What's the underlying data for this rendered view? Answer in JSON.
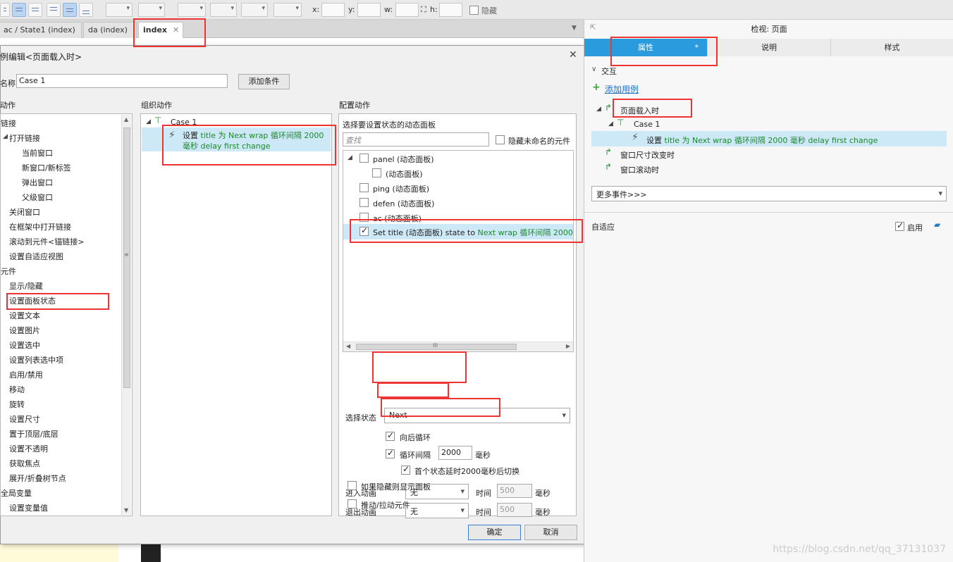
{
  "toolbar": {
    "x_label": "x:",
    "y_label": "y:",
    "w_label": "w:",
    "h_label": "h:",
    "hidden_label": "隐藏"
  },
  "tabs": [
    {
      "label": "ac / State1 (index)"
    },
    {
      "label": "da (index)"
    },
    {
      "label": "index",
      "close": "✕"
    }
  ],
  "dialog": {
    "title": "例编辑<页面载入时>",
    "close": "✕",
    "name_label": "名称",
    "name_value": "Case 1",
    "add_condition": "添加条件",
    "col1_header": "动作",
    "col2_header": "组织动作",
    "col3_header": "配置动作",
    "actions": [
      "链接",
      "打开链接",
      "当前窗口",
      "新窗口/新标签",
      "弹出窗口",
      "父级窗口",
      "关闭窗口",
      "在框架中打开链接",
      "滚动到元件<锚链接>",
      "设置自适应视图",
      "元件",
      "显示/隐藏",
      "设置面板状态",
      "设置文本",
      "设置图片",
      "设置选中",
      "设置列表选中项",
      "启用/禁用",
      "移动",
      "旋转",
      "设置尺寸",
      "置于顶层/底层",
      "设置不透明",
      "获取焦点",
      "展开/折叠树节点",
      "全局变量",
      "设置变量值"
    ],
    "organize": {
      "case": "Case 1",
      "action_prefix": "设置",
      "action_text": "title 为 Next wrap 循环间隔 2000 毫秒 delay first change"
    },
    "config": {
      "select_panel_label": "选择要设置状态的动态面板",
      "search_placeholder": "查找",
      "hide_unnamed": "隐藏未命名的元件",
      "panels": [
        "panel (动态面板)",
        "(动态面板)",
        "ping (动态面板)",
        "defen (动态面板)",
        "ac (动态面板)"
      ],
      "selected_prefix": "Set title (动态面板) state to",
      "selected_suffix": "Next wrap 循环间隔 2000 毫秒",
      "scroll_grip": "III",
      "select_state_label": "选择状态",
      "state_value": "Next",
      "wrap_label": "向后循环",
      "interval_label": "循环间隔",
      "interval_value": "2000",
      "ms": "毫秒",
      "first_delay_label": "首个状态延时2000毫秒后切换",
      "enter_anim_label": "进入动画",
      "exit_anim_label": "退出动画",
      "anim_value": "无",
      "time_label": "时间",
      "time_value": "500",
      "show_if_hidden": "如果隐藏则显示面板",
      "push_widgets": "推动/拉动元件"
    },
    "ok": "确定",
    "cancel": "取消"
  },
  "inspector": {
    "header": "检视: 页面",
    "tabs": [
      "属性",
      "说明",
      "样式"
    ],
    "tab_star": "*",
    "interaction_label": "交互",
    "add_case": "添加用例",
    "events": {
      "page_load": "页面载入时",
      "case": "Case 1",
      "action_prefix": "设置",
      "action_text": "title 为 Next wrap 循环间隔 2000 毫秒 delay first change",
      "resize": "窗口尺寸改变时",
      "scroll": "窗口滚动时"
    },
    "more_events": "更多事件>>>",
    "adaptive_label": "自适应",
    "enable_label": "启用"
  },
  "watermark": "https://blog.csdn.net/qq_37131037",
  "colors": {
    "accent_blue": "#2a9bdc",
    "highlight": "#cde8f7",
    "green_text": "#1b8a2b",
    "annotation_red": "#e33333"
  }
}
